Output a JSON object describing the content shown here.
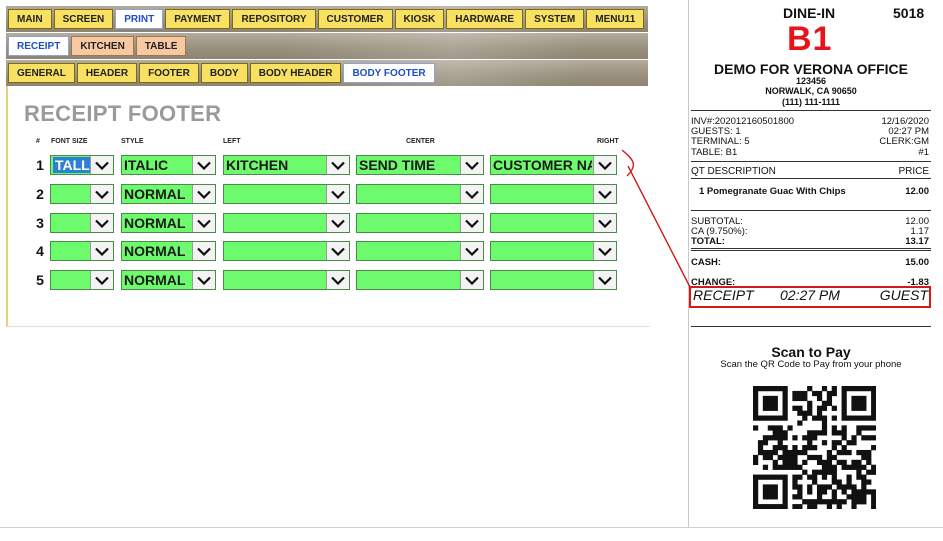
{
  "nav": {
    "main_tabs": [
      "MAIN",
      "SCREEN",
      "PRINT",
      "PAYMENT",
      "REPOSITORY",
      "CUSTOMER",
      "KIOSK",
      "HARDWARE",
      "SYSTEM",
      "MENU11"
    ],
    "sub_tabs": [
      "RECEIPT",
      "KITCHEN",
      "TABLE"
    ],
    "section_tabs": [
      "GENERAL",
      "HEADER",
      "FOOTER",
      "BODY",
      "BODY HEADER",
      "BODY FOOTER"
    ]
  },
  "panel": {
    "title": "RECEIPT FOOTER",
    "columns": {
      "num": "#",
      "font_size": "FONT SIZE",
      "style": "STYLE",
      "left": "LEFT",
      "center": "CENTER",
      "right": "RIGHT"
    },
    "rows": [
      {
        "num": "1",
        "font_size": "TALL",
        "style": "ITALIC",
        "left": "KITCHEN",
        "center": "SEND TIME",
        "right": "CUSTOMER NAME"
      },
      {
        "num": "2",
        "font_size": "",
        "style": "NORMAL",
        "left": "",
        "center": "",
        "right": ""
      },
      {
        "num": "3",
        "font_size": "",
        "style": "NORMAL",
        "left": "",
        "center": "",
        "right": ""
      },
      {
        "num": "4",
        "font_size": "",
        "style": "NORMAL",
        "left": "",
        "center": "",
        "right": ""
      },
      {
        "num": "5",
        "font_size": "",
        "style": "NORMAL",
        "left": "",
        "center": "",
        "right": ""
      }
    ]
  },
  "receipt": {
    "order_type": "DINE-IN",
    "order_number": "5018",
    "table_big": "B1",
    "store_name": "DEMO FOR VERONA OFFICE",
    "address1": "123456",
    "address2": "NORWALK, CA 90650",
    "phone": "(111) 111-1111",
    "inv": "INV#:202012160501800",
    "date": "12/16/2020",
    "guests": "GUESTS: 1",
    "time": "02:27 PM",
    "terminal": "TERMINAL: 5",
    "clerk": "CLERK:GM",
    "table": "TABLE: B1",
    "table_no": "#1",
    "col_desc": "QT DESCRIPTION",
    "col_price": "PRICE",
    "item_name": "1 Pomegranate Guac With Chips",
    "item_price": "12.00",
    "subtotal_label": "SUBTOTAL:",
    "subtotal": "12.00",
    "tax_label": "CA (9.750%):",
    "tax": "1.17",
    "total_label": "TOTAL:",
    "total": "13.17",
    "cash_label": "CASH:",
    "cash": "15.00",
    "change_label": "CHANGE:",
    "change": "-1.83",
    "footer_left": "RECEIPT",
    "footer_center": "02:27 PM",
    "footer_right": "GUEST",
    "scan_title": "Scan to Pay",
    "scan_sub": "Scan the QR Code to Pay from your phone"
  },
  "colors": {
    "dropdown_green": "#6dfa6d",
    "tab_yellow": "#f8e060",
    "tab_pink": "#f6c9a2",
    "active_tab_text": "#1e4fc4",
    "callout_red": "#d11a1a",
    "b1_red": "#e8141a"
  }
}
